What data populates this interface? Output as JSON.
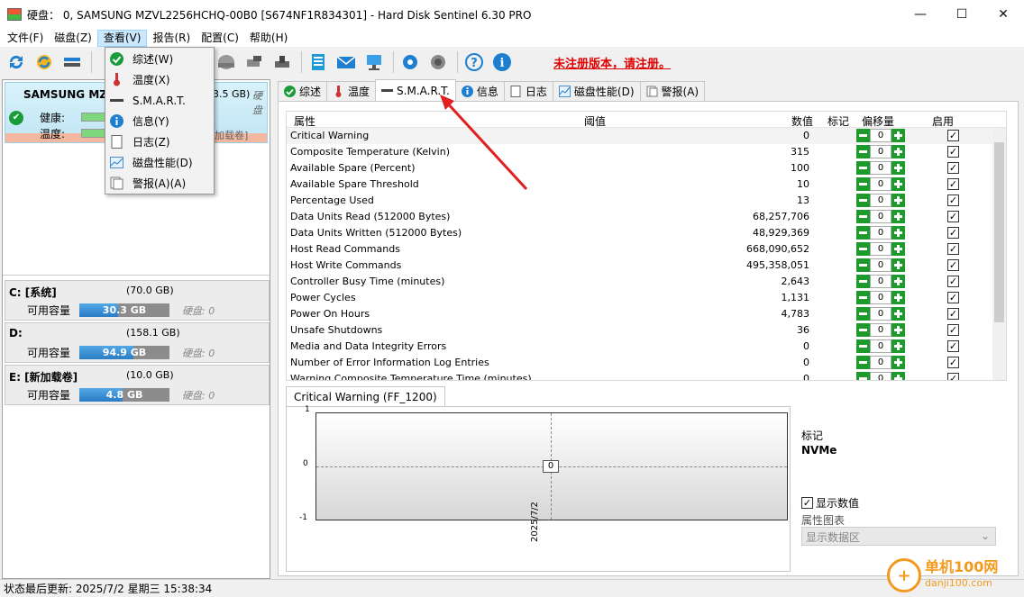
{
  "window": {
    "title": "硬盘： 0, SAMSUNG MZVL2256HCHQ-00B0 [S674NF1R834301]  -  Hard Disk Sentinel 6.30 PRO",
    "minimize": "—",
    "maximize": "☐",
    "close": "✕"
  },
  "menu": [
    "文件(F)",
    "磁盘(Z)",
    "查看(V)",
    "报告(R)",
    "配置(C)",
    "帮助(H)"
  ],
  "unregistered": "未注册版本，请注册。",
  "disk": {
    "name": "SAMSUNG MZV",
    "size": "3.5 GB)",
    "disk_label": "硬盘",
    "health_label": "健康:",
    "temp_label": "温度:",
    "volume": "加载卷]"
  },
  "partitions": [
    {
      "name": "C: [系统]",
      "size": "(70.0 GB)",
      "free_label": "可用容量",
      "free": "30.3 GB",
      "fill": 0.43,
      "disk": "硬盘:  0"
    },
    {
      "name": "D:",
      "size": "(158.1 GB)",
      "free_label": "可用容量",
      "free": "94.9 GB",
      "fill": 0.6,
      "disk": "硬盘:  0"
    },
    {
      "name": "E: [新加载卷]",
      "size": "(10.0 GB)",
      "free_label": "可用容量",
      "free": "4.8 GB",
      "fill": 0.48,
      "disk": "硬盘:  0"
    }
  ],
  "tabs": [
    "综述",
    "温度",
    "S.M.A.R.T.",
    "信息",
    "日志",
    "磁盘性能(D)",
    "警报(A)"
  ],
  "table": {
    "headers": {
      "attr": "属性",
      "threshold": "阈值",
      "value": "数值",
      "flag": "标记",
      "offset": "偏移量",
      "enabled": "启用"
    },
    "rows": [
      {
        "name": "Critical Warning",
        "value": "0",
        "offset": "0"
      },
      {
        "name": "Composite Temperature (Kelvin)",
        "value": "315",
        "offset": "0"
      },
      {
        "name": "Available Spare (Percent)",
        "value": "100",
        "offset": "0"
      },
      {
        "name": "Available Spare Threshold",
        "value": "10",
        "offset": "0"
      },
      {
        "name": "Percentage Used",
        "value": "13",
        "offset": "0"
      },
      {
        "name": "Data Units Read (512000 Bytes)",
        "value": "68,257,706",
        "offset": "0"
      },
      {
        "name": "Data Units Written (512000 Bytes)",
        "value": "48,929,369",
        "offset": "0"
      },
      {
        "name": "Host Read Commands",
        "value": "668,090,652",
        "offset": "0"
      },
      {
        "name": "Host Write Commands",
        "value": "495,358,051",
        "offset": "0"
      },
      {
        "name": "Controller Busy Time (minutes)",
        "value": "2,643",
        "offset": "0"
      },
      {
        "name": "Power Cycles",
        "value": "1,131",
        "offset": "0"
      },
      {
        "name": "Power On Hours",
        "value": "4,783",
        "offset": "0"
      },
      {
        "name": "Unsafe Shutdowns",
        "value": "36",
        "offset": "0"
      },
      {
        "name": "Media and Data Integrity Errors",
        "value": "0",
        "offset": "0"
      },
      {
        "name": "Number of Error Information Log Entries",
        "value": "0",
        "offset": "0"
      },
      {
        "name": "Warning Composite Temperature Time (minutes)",
        "value": "0",
        "offset": "0"
      }
    ]
  },
  "chart": {
    "tab": "Critical Warning (FF_1200)",
    "y_ticks": [
      "1",
      "0",
      "-1"
    ],
    "point_label": "0",
    "x_label": "2025/7/2",
    "flag_label": "标记",
    "flag_value": "NVMe",
    "show_values": "显示数值",
    "attr_chart_label": "属性图表",
    "attr_chart_select": "显示数据区"
  },
  "status": "状态最后更新:   2025/7/2 星期三 15:38:34",
  "dropdown": [
    {
      "label": "综述(W)",
      "icon": "check-icon"
    },
    {
      "label": "温度(X)",
      "icon": "thermometer-icon"
    },
    {
      "label": "S.M.A.R.T.",
      "icon": "smart-icon"
    },
    {
      "label": "信息(Y)",
      "icon": "info-icon"
    },
    {
      "label": "日志(Z)",
      "icon": "log-icon"
    },
    {
      "label": "磁盘性能(D)",
      "icon": "performance-icon"
    },
    {
      "label": "警报(A)(A)",
      "icon": "alert-icon"
    }
  ],
  "watermark": {
    "logo": "+",
    "text": "单机100网",
    "sub": "danji100.com"
  },
  "colors": {
    "accent": "#1c9a2c",
    "unregistered": "#e00000",
    "bar": "#2a7cc4"
  }
}
